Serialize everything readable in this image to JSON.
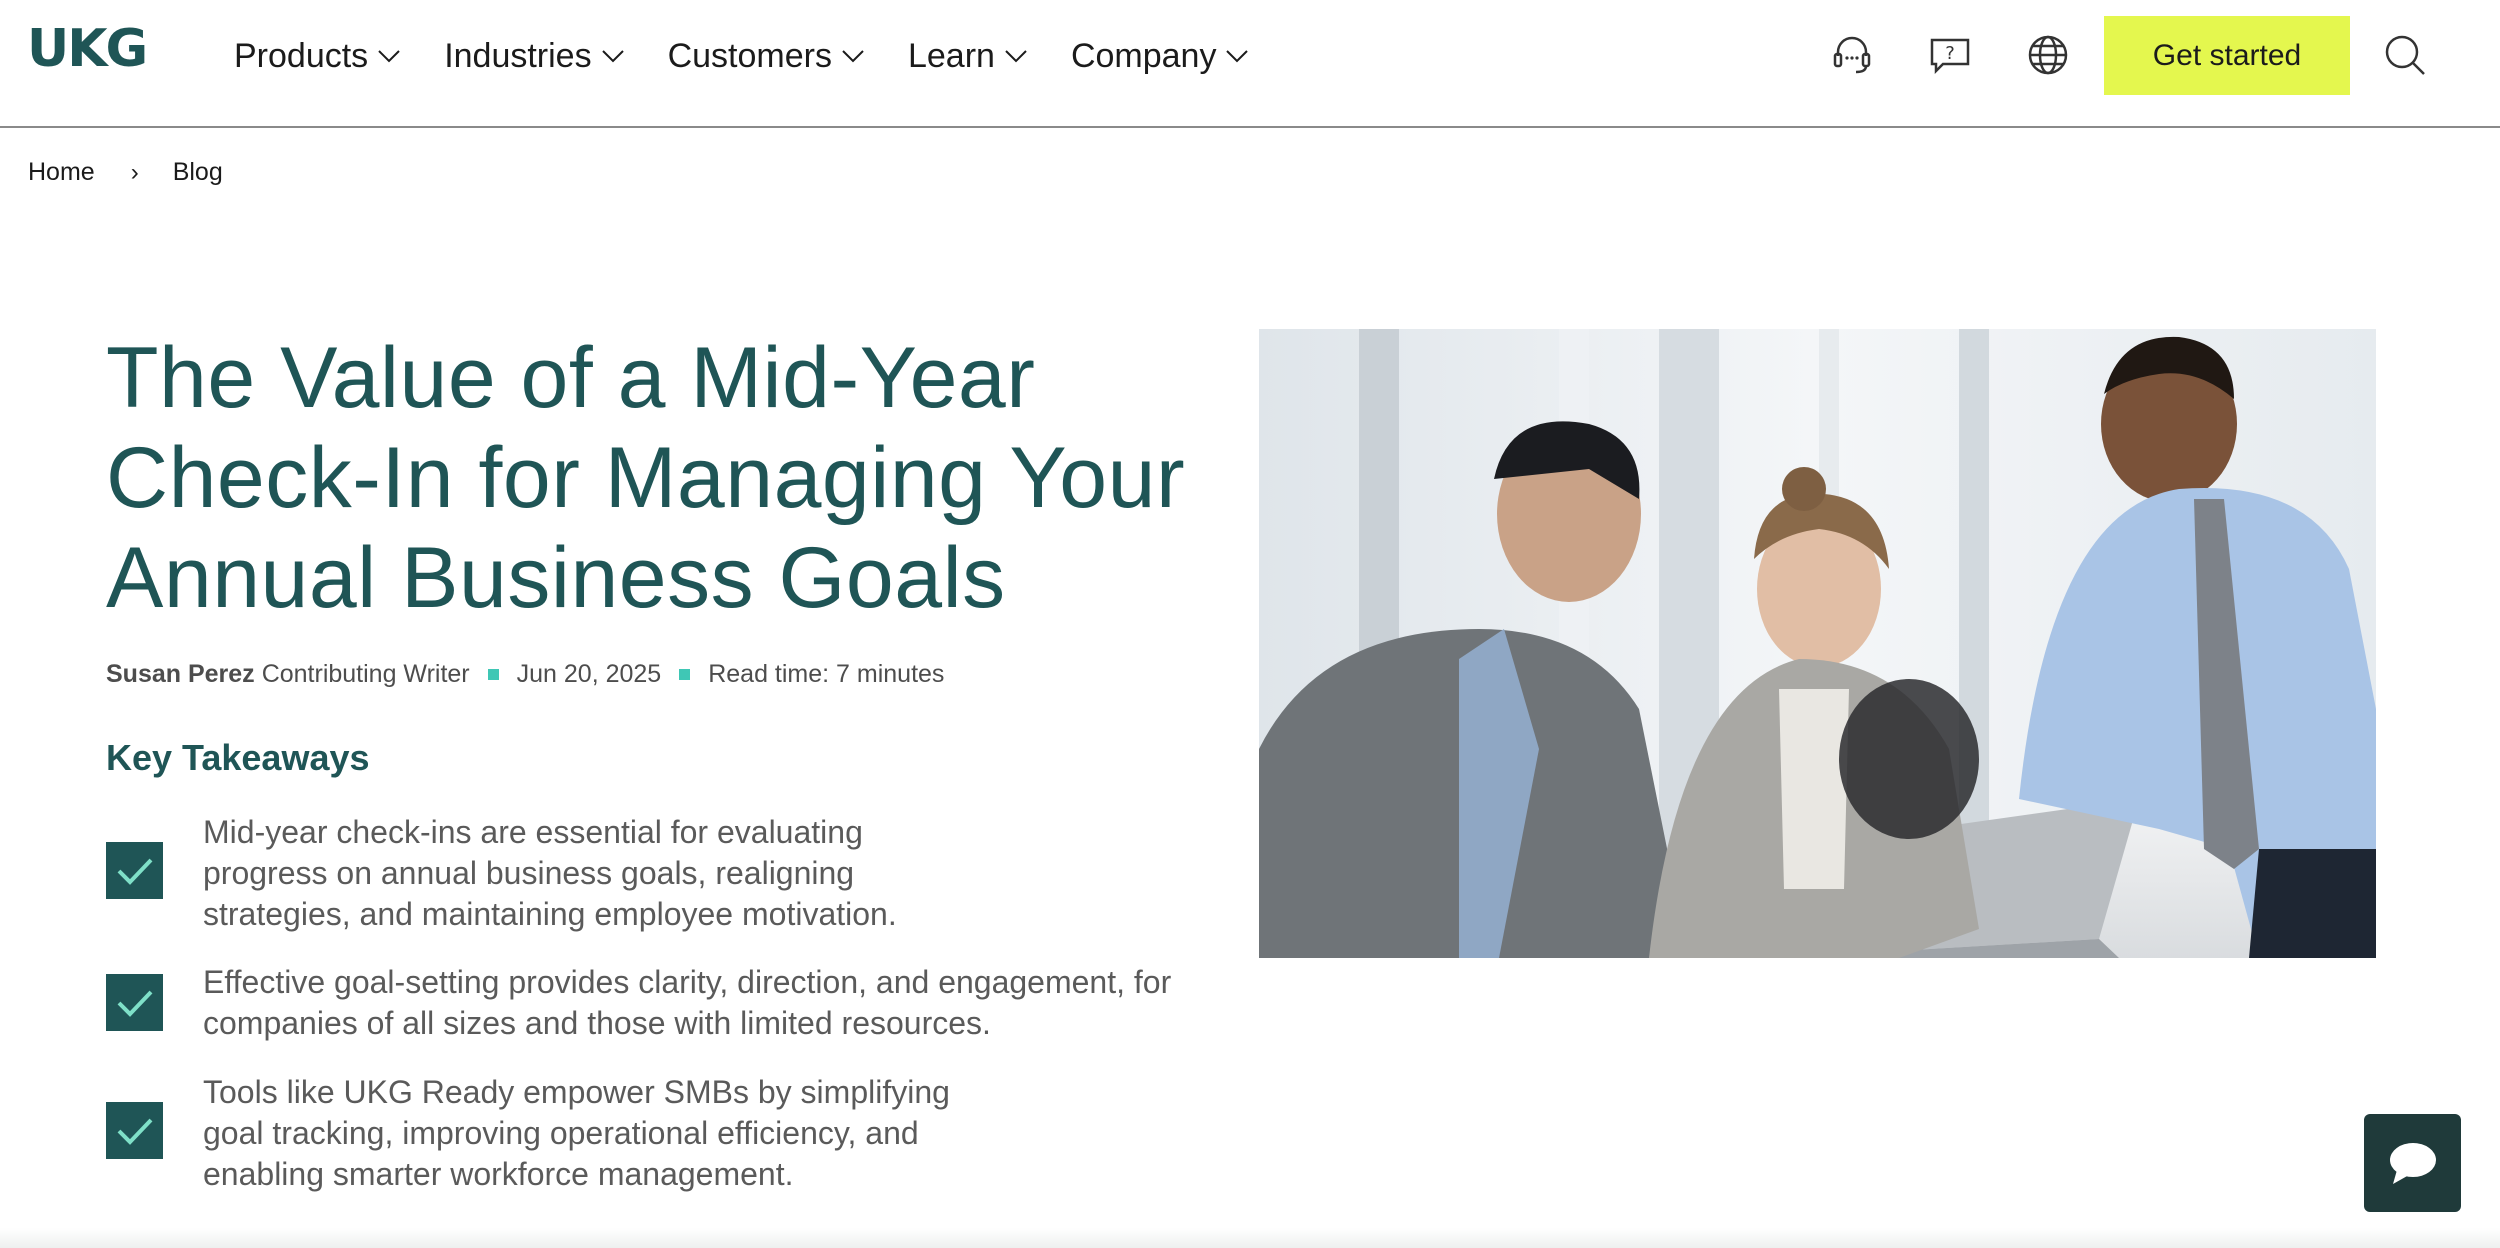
{
  "header": {
    "logo_text": "UKG",
    "nav": [
      {
        "label": "Products"
      },
      {
        "label": "Industries"
      },
      {
        "label": "Customers"
      },
      {
        "label": "Learn"
      },
      {
        "label": "Company"
      }
    ],
    "icons": [
      "support-headset-icon",
      "help-chat-icon",
      "globe-icon",
      "search-icon"
    ],
    "cta_label": "Get started",
    "cta_color": "#e4f74e"
  },
  "breadcrumb": {
    "home": "Home",
    "separator": "›",
    "current": "Blog"
  },
  "article": {
    "title": "The Value of a Mid-Year Check-In for Managing Your Annual Business Goals",
    "author": "Susan Perez",
    "author_role": "Contributing Writer",
    "date": "Jun 20, 2025",
    "read_time": "Read time: 7 minutes",
    "key_takeaways_heading": "Key Takeaways",
    "takeaways": [
      {
        "text": "Mid-year check-ins are essential for evaluating progress on annual business goals, realigning strategies, and maintaining employee motivation."
      },
      {
        "text": "Effective goal-setting provides clarity, direction, and engagement, for companies of all sizes and those with limited resources."
      },
      {
        "text": "Tools like UKG Ready empower SMBs by simplifying goal tracking, improving operational efficiency, and enabling smarter workforce management."
      }
    ]
  },
  "colors": {
    "brand_teal": "#1f5556",
    "accent_dot": "#3fc7b5",
    "chat_bg": "#1f3a3a"
  },
  "chat_icon": "chat-bubble-icon"
}
